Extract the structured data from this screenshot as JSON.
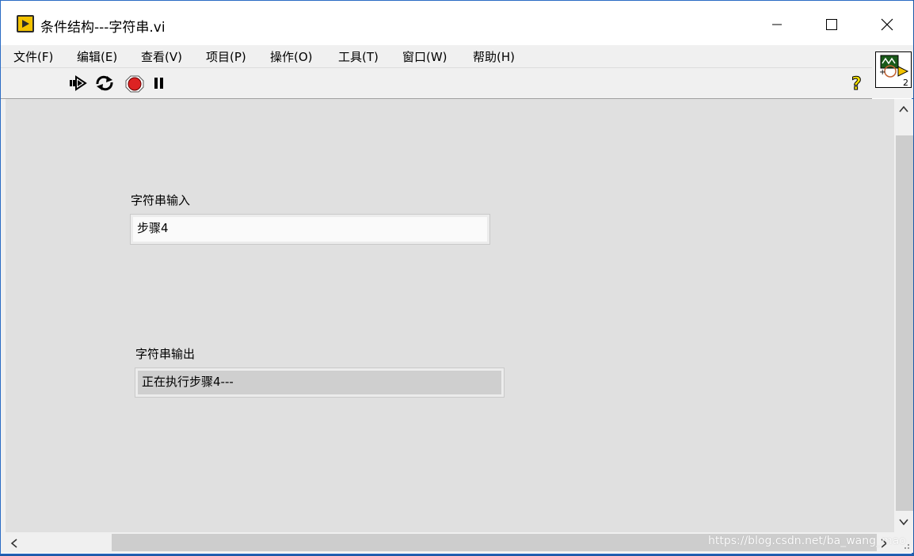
{
  "window": {
    "title": "条件结构---字符串.vi"
  },
  "menu": [
    "文件(F)",
    "编辑(E)",
    "查看(V)",
    "项目(P)",
    "操作(O)",
    "工具(T)",
    "窗口(W)",
    "帮助(H)"
  ],
  "toolbar": {
    "icons": [
      "run-arrow-icon",
      "run-continuously-icon",
      "abort-icon",
      "pause-icon"
    ],
    "help": "?"
  },
  "vi_icon": {
    "number": "2"
  },
  "panel": {
    "input_label": "字符串输入",
    "input_value": "步骤4",
    "output_label": "字符串输出",
    "output_value": "正在执行步骤4---"
  },
  "watermark": "https://blog.csdn.net/ba_wang_mao",
  "colors": {
    "panel_bg": "#e0e0e0",
    "input_bg": "#fafafa",
    "indicator_bg": "#cfcfcf"
  }
}
